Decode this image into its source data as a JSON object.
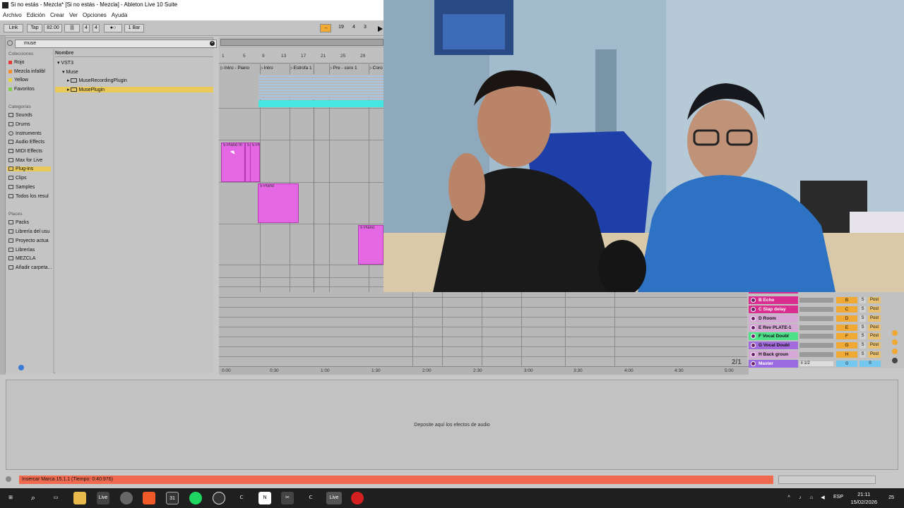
{
  "window": {
    "title": "Si no estás - Mezcla* [Si no estás - Mezcla] - Ableton Live 10 Suite"
  },
  "menu": [
    "Archivo",
    "Edición",
    "Crear",
    "Ver",
    "Opciones",
    "Ayuda"
  ],
  "control": {
    "link": "Link",
    "tap": "Tap",
    "tempo": "82.00",
    "sig_num": "4",
    "sig_den": "4",
    "quant": "1 Bar",
    "position": [
      "19",
      "4",
      "3"
    ]
  },
  "browser": {
    "search": "muse",
    "collections_header": "Colecciones",
    "collections": [
      {
        "label": "Rojo",
        "color": "#e53935"
      },
      {
        "label": "Mezcla infalibl",
        "color": "#f28c28"
      },
      {
        "label": "Yellow",
        "color": "#e5d33a"
      },
      {
        "label": "Favoritos",
        "color": "#7fcf4a"
      }
    ],
    "categories_header": "Categorías",
    "categories": [
      "Sounds",
      "Drums",
      "Instruments",
      "Audio Effects",
      "MIDI Effects",
      "Max for Live",
      "Plug-ins",
      "Clips",
      "Samples",
      "Todos los resul"
    ],
    "selected_category": "Plug-ins",
    "places_header": "Places",
    "places": [
      "Packs",
      "Librería del usu",
      "Proyecto actua",
      "Librerías",
      "MEZCLA",
      "Añadir carpeta..."
    ],
    "name_header": "Nombre",
    "tree": [
      "VST3",
      "Muse",
      "MuseRecordingPlugin",
      "MusePlugin"
    ]
  },
  "arrangement": {
    "bar_numbers": [
      "1",
      "5",
      "9",
      "13",
      "17",
      "21",
      "25",
      "29"
    ],
    "locators": [
      "Intro - Piano",
      "Intro",
      "Estrofa 1",
      "Pre - coro 1",
      "Coro"
    ],
    "clips": [
      "5 Piano In",
      "5 Pi",
      "5 Pi",
      "5 Piano",
      "5 Piano"
    ],
    "time_ruler": [
      "0:00",
      "0:30",
      "1:00",
      "1:30",
      "2:00",
      "2:30",
      "3:00",
      "3:30",
      "4:00",
      "4:30",
      "5:00"
    ],
    "page_counter": "2/1"
  },
  "returns": [
    {
      "name": "B Echo",
      "letter": "B",
      "color": "#d92e8f"
    },
    {
      "name": "C Slap delay",
      "letter": "C",
      "color": "#d92e8f"
    },
    {
      "name": "D Room",
      "letter": "D",
      "color": "#d6a8d6"
    },
    {
      "name": "E Rev PLATE-1",
      "letter": "E",
      "color": "#d6a8d6"
    },
    {
      "name": "F Vocal Doubl",
      "letter": "F",
      "color": "#4fe08a"
    },
    {
      "name": "G Vocal Doubl",
      "letter": "G",
      "color": "#a46bdc"
    },
    {
      "name": "H Back groun",
      "letter": "H",
      "color": "#d6a8d6"
    }
  ],
  "master": {
    "name": "Master",
    "cue": "ii 1/2",
    "solo_val": "0",
    "post_val": "0",
    "color": "#9a6be0"
  },
  "return_labels": {
    "solo": "S",
    "post": "Post"
  },
  "device_area": {
    "drop_message": "Deposite aquí los efectos de audio"
  },
  "status": {
    "message": "Insercar Marca 15.1.1 (Tiempo: 0:40:976)"
  },
  "taskbar": {
    "language": "ESP",
    "time": "21:11",
    "date": "15/02/2026",
    "notif_count": "25"
  }
}
